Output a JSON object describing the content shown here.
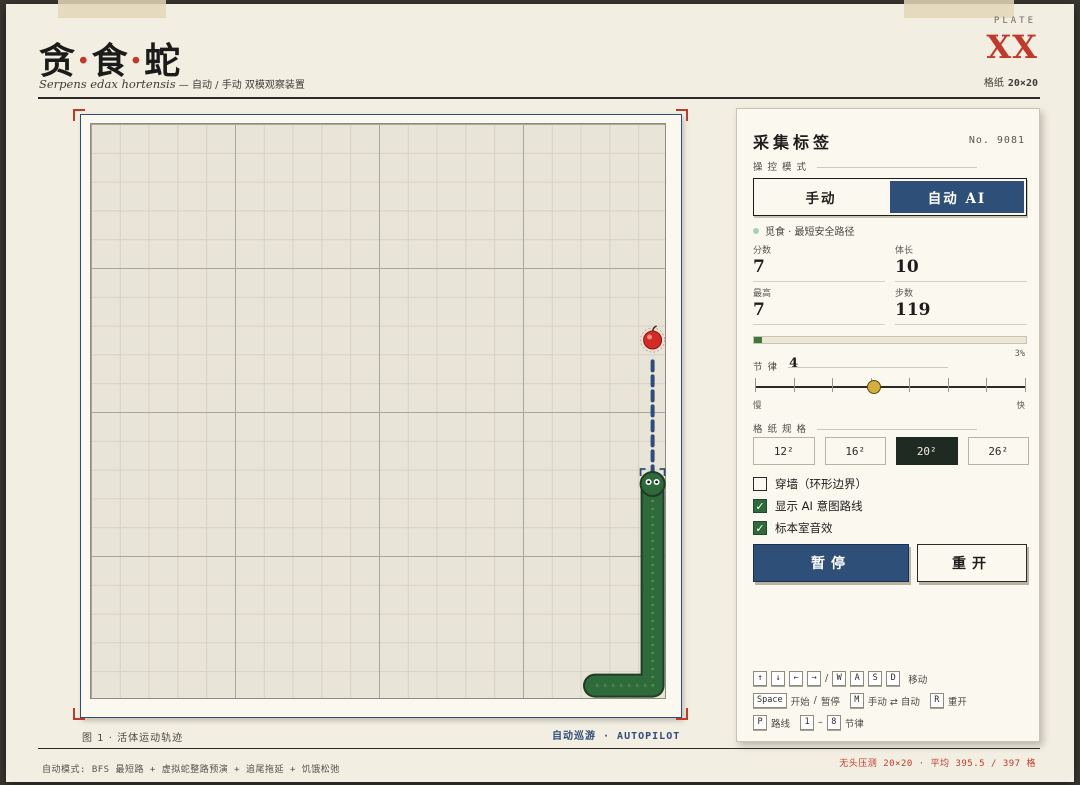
{
  "header": {
    "title_parts": [
      "贪",
      "食",
      "蛇"
    ],
    "title_dot": "·",
    "subtitle_latin": "Serpens edax hortensis",
    "subtitle_cn": " — 自动 / 手动 双模观察装置",
    "plate_label": "PLATE",
    "plate_number": "XX",
    "paper_label": "格纸",
    "paper_size": "20×20"
  },
  "board": {
    "grid_size": 20,
    "food": {
      "col": 19,
      "row": 7
    },
    "snake": [
      [
        19,
        12
      ],
      [
        19,
        13
      ],
      [
        19,
        14
      ],
      [
        19,
        15
      ],
      [
        19,
        16
      ],
      [
        19,
        17
      ],
      [
        19,
        18
      ],
      [
        19,
        19
      ],
      [
        18,
        19
      ],
      [
        17,
        19
      ]
    ],
    "ai_path": [
      [
        19,
        12
      ],
      [
        19,
        11
      ],
      [
        19,
        10
      ],
      [
        19,
        9
      ],
      [
        19,
        8
      ],
      [
        19,
        7
      ]
    ],
    "caption": "图  1  ·  活体运动轨迹",
    "mode_tag": "自动巡游  ·  AUTOPILOT",
    "colors": {
      "snake": "#2f6a3a",
      "snake_outline": "#1f3d24",
      "food": "#d12b25",
      "path": "#2f4d7a"
    }
  },
  "panel": {
    "title": "采集标签",
    "serial": "No. 9081",
    "mode_label": "操控模式",
    "mode_manual": "手动",
    "mode_auto": "自动 AI",
    "status_text": "觅食  ·  最短安全路径",
    "stats": {
      "score_label": "分数",
      "score": "7",
      "length_label": "体长",
      "length": "10",
      "best_label": "最高",
      "best": "7",
      "steps_label": "步数",
      "steps": "119"
    },
    "progress_fraction": 0.03,
    "progress_text": "3%",
    "tempo_label": "节律",
    "tempo_value": "4",
    "tempo_fraction": 0.44,
    "slow_label": "慢",
    "fast_label": "快",
    "size_label": "格纸规格",
    "sizes": [
      "12²",
      "16²",
      "20²",
      "26²"
    ],
    "options": {
      "wrap_label": "穿墙（环形边界）",
      "path_label": "显示 AI 意图路线",
      "sound_label": "标本室音效"
    },
    "pause_label": "暂停",
    "restart_label": "重开",
    "help": {
      "arrows": [
        "↑",
        "↓",
        "←",
        "→"
      ],
      "slash": "/",
      "wasd": [
        "W",
        "A",
        "S",
        "D"
      ],
      "move": "移动",
      "space": "Space",
      "start": "开始",
      "pause": "暂停",
      "m_key": "M",
      "toggle": "手动 ⇄ 自动",
      "r_key": "R",
      "restart": "重开",
      "p_key": "P",
      "path": "路线",
      "one": "1",
      "dash": "–",
      "eight": "8",
      "tempo": "节律"
    }
  },
  "footer": {
    "left": "自动模式: BFS 最短路  +  虚拟蛇整路预演  +  追尾拖延  +  饥饿松弛",
    "right": "无头压测 20×20 · 平均 395.5 / 397 格"
  }
}
